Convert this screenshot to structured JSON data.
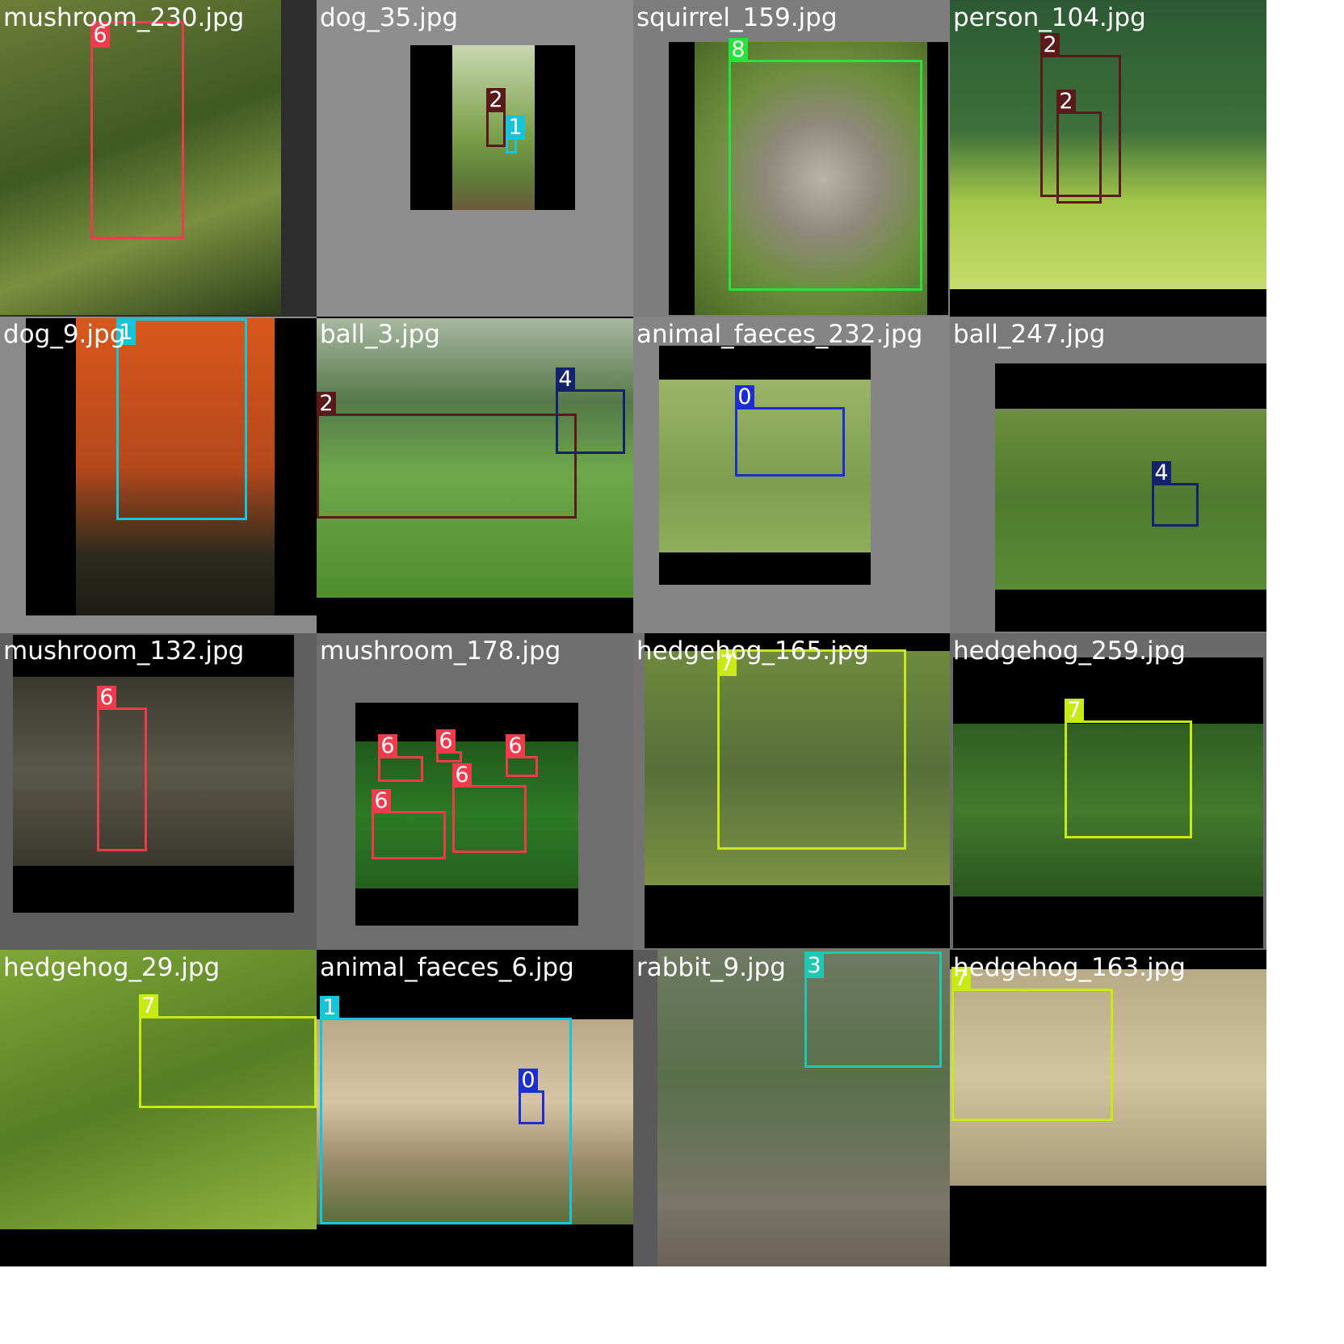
{
  "grid": {
    "columns": 4,
    "rows": 4
  },
  "class_colors": {
    "0": "#1b2fd0",
    "1": "#18c4d8",
    "2": "#5a1a1a",
    "3": "#1fc9b1",
    "4": "#13236b",
    "6": "#f03b4c",
    "7": "#c8ea14",
    "8": "#24e43c"
  },
  "tiles": [
    {
      "label": "mushroom_230.jpg",
      "canvas": "#2d2d2d",
      "boxes": [
        {
          "cls": "6"
        }
      ]
    },
    {
      "label": "dog_35.jpg",
      "canvas": "#8e8e8e",
      "boxes": [
        {
          "cls": "2"
        },
        {
          "cls": "1"
        }
      ]
    },
    {
      "label": "squirrel_159.jpg",
      "canvas": "#7d7d7d",
      "boxes": [
        {
          "cls": "8"
        }
      ]
    },
    {
      "label": "person_104.jpg",
      "canvas": "#000000",
      "boxes": [
        {
          "cls": "2"
        },
        {
          "cls": "2"
        }
      ]
    },
    {
      "label": "dog_9.jpg",
      "canvas": "#8a8a8a",
      "boxes": [
        {
          "cls": "1"
        }
      ]
    },
    {
      "label": "ball_3.jpg",
      "canvas": "#000000",
      "boxes": [
        {
          "cls": "2"
        },
        {
          "cls": "4"
        }
      ]
    },
    {
      "label": "animal_faeces_232.jpg",
      "canvas": "#858585",
      "boxes": [
        {
          "cls": "0"
        }
      ]
    },
    {
      "label": "ball_247.jpg",
      "canvas": "#7a7a7a",
      "boxes": [
        {
          "cls": "4"
        }
      ]
    },
    {
      "label": "mushroom_132.jpg",
      "canvas": "#5e5e5e",
      "boxes": [
        {
          "cls": "6"
        }
      ]
    },
    {
      "label": "mushroom_178.jpg",
      "canvas": "#6e6e6e",
      "boxes": [
        {
          "cls": "6"
        },
        {
          "cls": "6"
        },
        {
          "cls": "6"
        },
        {
          "cls": "6"
        },
        {
          "cls": "6"
        }
      ]
    },
    {
      "label": "hedgehog_165.jpg",
      "canvas": "#747474",
      "boxes": [
        {
          "cls": "7"
        }
      ]
    },
    {
      "label": "hedgehog_259.jpg",
      "canvas": "#6a6a6a",
      "boxes": [
        {
          "cls": "7"
        }
      ]
    },
    {
      "label": "hedgehog_29.jpg",
      "canvas": "#000000",
      "boxes": [
        {
          "cls": "7"
        }
      ]
    },
    {
      "label": "animal_faeces_6.jpg",
      "canvas": "#000000",
      "boxes": [
        {
          "cls": "1"
        },
        {
          "cls": "0"
        }
      ]
    },
    {
      "label": "rabbit_9.jpg",
      "canvas": "#5a5a5a",
      "boxes": [
        {
          "cls": "3"
        }
      ]
    },
    {
      "label": "hedgehog_163.jpg",
      "canvas": "#000000",
      "boxes": [
        {
          "cls": "7"
        }
      ]
    }
  ]
}
